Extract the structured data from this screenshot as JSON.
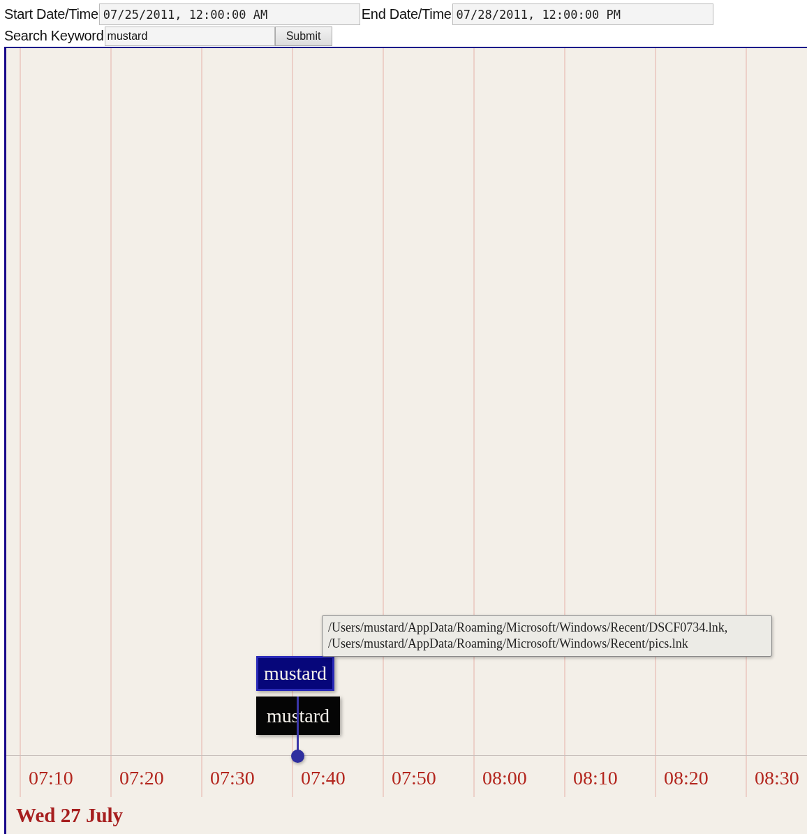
{
  "form": {
    "start_label": "Start Date/Time",
    "start_value": "07/25/2011, 12:00:00 AM",
    "end_label": "End Date/Time",
    "end_value": "07/28/2011, 12:00:00 PM",
    "keyword_label": "Search Keyword",
    "keyword_value": "mustard",
    "submit": "Submit"
  },
  "timeline": {
    "ticks": [
      "07:10",
      "07:20",
      "07:30",
      "07:40",
      "07:50",
      "08:00",
      "08:10",
      "08:20",
      "08:30"
    ],
    "date_label": "Wed 27 July",
    "events": [
      {
        "label": "mustard",
        "selected": true
      },
      {
        "label": "mustard",
        "selected": false
      }
    ],
    "tooltip": {
      "lines": [
        "/Users/mustard/AppData/Roaming/Microsoft/Windows/Recent/DSCF0734.lnk,",
        "/Users/mustard/AppData/Roaming/Microsoft/Windows/Recent/pics.lnk"
      ]
    }
  }
}
